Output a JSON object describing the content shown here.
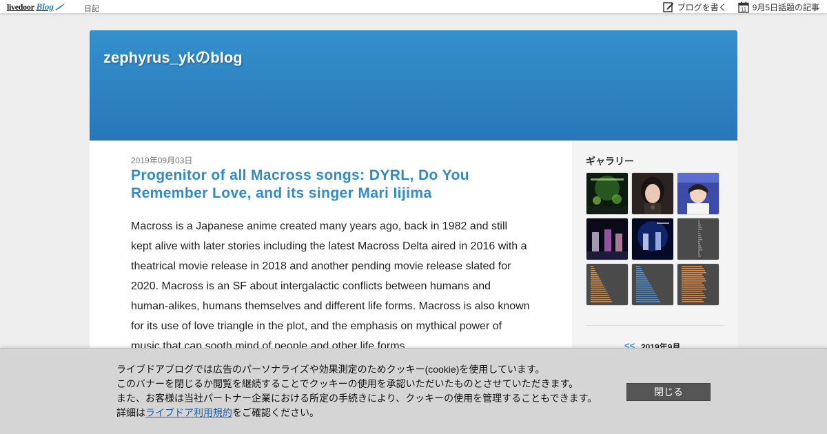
{
  "topbar": {
    "logo_text": "livedoor",
    "logo_blog": "Blog",
    "nav_diary": "日記",
    "write_label": "ブログを書く",
    "topic_label": "9月5日話題の記事",
    "calendar_icon_day": "11"
  },
  "blog": {
    "title": "zephyrus_ykのblog",
    "header_color": "#2f86c5"
  },
  "post": {
    "date": "2019年09月03日",
    "title": "Progenitor of all Macross songs: DYRL, Do You Remember Love, and its singer Mari Iijima",
    "body": "Macross is a Japanese anime created many years ago, back in 1982 and still kept alive with later stories including the latest Macross Delta aired in 2016 with a theatrical movie release in 2018 and another pending movie release slated for 2020. Macross is an SF about intergalactic conflicts between humans and human-alikes, humans themselves and different life forms. Macross is also known for its use of love triangle in the plot, and the emphasis on mythical power of music that can sooth mind of people and other life forms."
  },
  "sidebar": {
    "gallery_title": "ギャラリー",
    "calendar_prev": "<<",
    "calendar_month": "2019年9月",
    "gallery": [
      {
        "name": "gallery-thumb-1",
        "kind": "stage-green"
      },
      {
        "name": "gallery-thumb-2",
        "kind": "portrait-dark"
      },
      {
        "name": "gallery-thumb-3",
        "kind": "portrait-blue"
      },
      {
        "name": "gallery-thumb-4",
        "kind": "stage-purple"
      },
      {
        "name": "gallery-thumb-5",
        "kind": "stage-blue"
      },
      {
        "name": "gallery-thumb-6",
        "kind": "chart-gray"
      },
      {
        "name": "gallery-thumb-7",
        "kind": "chart-orange-left"
      },
      {
        "name": "gallery-thumb-8",
        "kind": "chart-blue"
      },
      {
        "name": "gallery-thumb-9",
        "kind": "chart-orange"
      }
    ]
  },
  "cookie": {
    "line1": "ライブドアブログでは広告のパーソナライズや効果測定のためクッキー(cookie)を使用しています。",
    "line2": "このバナーを閉じるか閲覧を継続することでクッキーの使用を承認いただいたものとさせていただきます。",
    "line3": "また、お客様は当社パートナー企業における所定の手続きにより、クッキーの使用を管理することもできます。",
    "line4_prefix": "詳細は",
    "terms_link": "ライブドア利用規約",
    "line4_suffix": "をご確認ください。",
    "close_label": "閉じる"
  }
}
